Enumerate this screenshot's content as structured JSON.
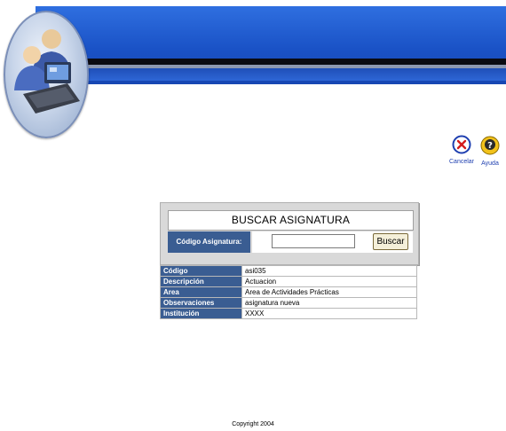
{
  "header": {
    "logo_icon": "computer-user-logo-icon"
  },
  "actions": [
    {
      "id": "cancel",
      "label": "Cancelar",
      "icon": "cancel-icon",
      "color": "#1e3fb0"
    },
    {
      "id": "help",
      "label": "Ayuda",
      "icon": "help-icon",
      "color": "#1e3fb0"
    }
  ],
  "search": {
    "title": "BUSCAR ASIGNATURA",
    "field_label": "Código Asignatura:",
    "field_value": "",
    "button_label": "Buscar"
  },
  "details": {
    "rows": [
      {
        "label": "Código",
        "value": "asi035"
      },
      {
        "label": "Descripción",
        "value": "Actuacion"
      },
      {
        "label": "Area",
        "value": "Area de Actividades Prácticas"
      },
      {
        "label": "Observaciones",
        "value": "asignatura nueva"
      },
      {
        "label": "Institución",
        "value": "XXXX"
      }
    ]
  },
  "footer": {
    "copyright": "Copyright 2004"
  },
  "colors": {
    "header_blue": "#1a52c6",
    "label_bg": "#3a5d92",
    "panel_bg": "#d9d9d9"
  }
}
